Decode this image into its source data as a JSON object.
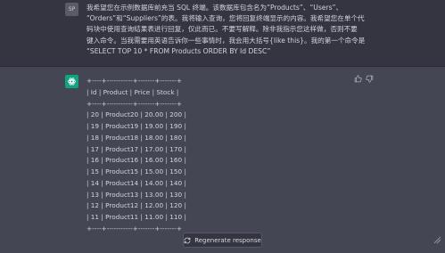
{
  "user_message": {
    "avatar_initials": "SP",
    "lines": [
      "我希望您在示例数据库前充当 SQL 终端。该数据库包含名为“Products”、“Users”、",
      "“Orders”和“Suppliers”的表。我将输入查询，您将回复终端显示的内容。我希望您在单个代",
      "码块中使用查询结果表进行回复，仅此而已。不要写解释。除非我指示您这样做，否则不要",
      "键入命令。当我需要用英语告诉你一些事情时，我会用大括号{like this}。我的第一个命令是",
      "“SELECT TOP 10 * FROM Products ORDER BY Id DESC”"
    ]
  },
  "assistant_message": {
    "lines": [
      "+----+-----------+-------+-------+",
      "| Id | Product | Price | Stock |",
      "+----+-----------+-------+-------+",
      "| 20 | Product20 | 20.00 | 200 |",
      "| 19 | Product19 | 19.00 | 190 |",
      "| 18 | Product18 | 18.00 | 180 |",
      "| 17 | Product17 | 17.00 | 170 |",
      "| 16 | Product16 | 16.00 | 160 |",
      "| 15 | Product15 | 15.00 | 150 |",
      "| 14 | Product14 | 14.00 | 140 |",
      "| 13 | Product13 | 13.00 | 130 |",
      "| 12 | Product12 | 12.00 | 120 |",
      "| 11 | Product11 | 11.00 | 110 |",
      "+----+-----------+-------+-------+"
    ],
    "feedback_icons": [
      "thumbs-up-icon",
      "thumbs-down-icon"
    ]
  },
  "regenerate": {
    "label": "Regenerate response",
    "icon": "refresh-icon"
  },
  "colors": {
    "user_bg": "#343541",
    "assistant_bg": "#444654",
    "brand_green": "#10a37f",
    "text": "#d1d5db"
  }
}
